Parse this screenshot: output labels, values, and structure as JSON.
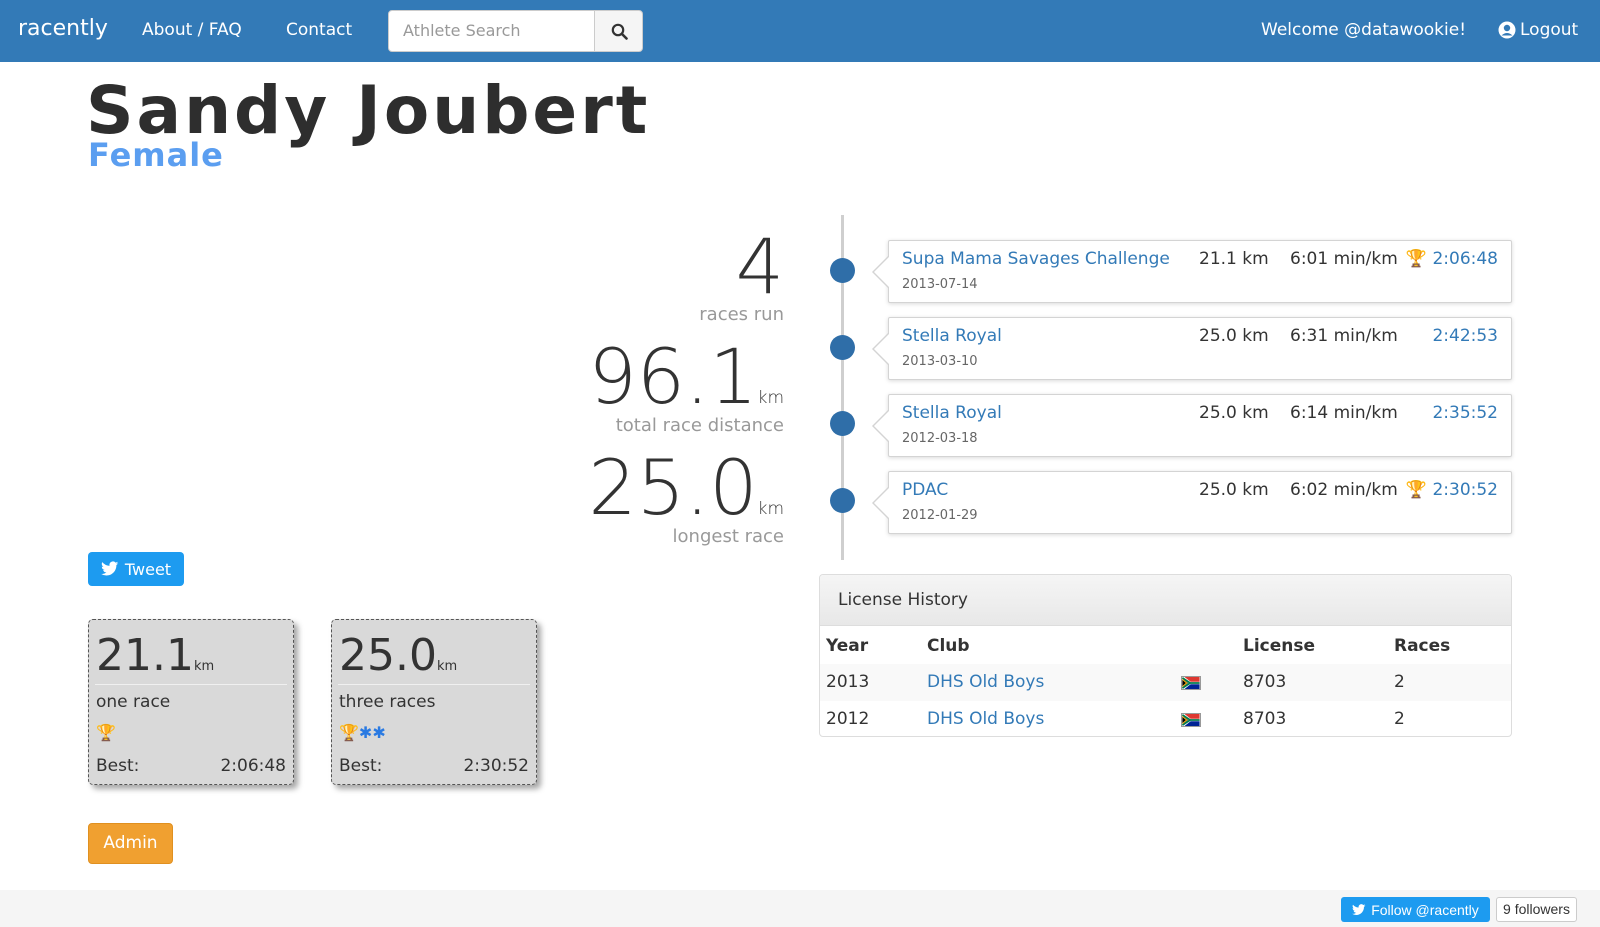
{
  "navbar": {
    "brand": "racently",
    "links": [
      "About / FAQ",
      "Contact"
    ],
    "search_placeholder": "Athlete Search",
    "welcome": "Welcome @datawookie!",
    "logout": "Logout"
  },
  "athlete": {
    "name": "Sandy Joubert",
    "gender": "Female"
  },
  "stats": {
    "races_run": "4",
    "races_run_label": "races run",
    "total_distance": "96.1",
    "total_distance_unit": "km",
    "total_distance_label": "total race distance",
    "longest": "25.0",
    "longest_unit": "km",
    "longest_label": "longest race"
  },
  "tweet_label": "Tweet",
  "distance_cards": [
    {
      "distance": "21.1",
      "unit": "km",
      "count": "one race",
      "trophies": 1,
      "stars": 0,
      "best_label": "Best:",
      "best_time": "2:06:48"
    },
    {
      "distance": "25.0",
      "unit": "km",
      "count": "three races",
      "trophies": 1,
      "stars": 2,
      "best_label": "Best:",
      "best_time": "2:30:52"
    }
  ],
  "admin_label": "Admin",
  "timeline": [
    {
      "name": "Supa Mama Savages Challenge",
      "date": "2013-07-14",
      "distance": "21.1 km",
      "pace": "6:01 min/km",
      "time": "2:06:48",
      "trophy": true
    },
    {
      "name": "Stella Royal",
      "date": "2013-03-10",
      "distance": "25.0 km",
      "pace": "6:31 min/km",
      "time": "2:42:53",
      "trophy": false
    },
    {
      "name": "Stella Royal",
      "date": "2012-03-18",
      "distance": "25.0 km",
      "pace": "6:14 min/km",
      "time": "2:35:52",
      "trophy": false
    },
    {
      "name": "PDAC",
      "date": "2012-01-29",
      "distance": "25.0 km",
      "pace": "6:02 min/km",
      "time": "2:30:52",
      "trophy": true
    }
  ],
  "license": {
    "title": "License History",
    "headers": [
      "Year",
      "Club",
      "License",
      "Races"
    ],
    "rows": [
      {
        "year": "2013",
        "club": "DHS Old Boys",
        "license": "8703",
        "races": "2"
      },
      {
        "year": "2012",
        "club": "DHS Old Boys",
        "license": "8703",
        "races": "2"
      }
    ]
  },
  "footer": {
    "follow_label": "Follow @racently",
    "followers": "9 followers"
  },
  "colors": {
    "navbar": "#337ab7",
    "gender": "#5b9ef0",
    "timeline_dot": "#2f6ea8",
    "trophy": "#d4a62a",
    "admin": "#f0a030"
  }
}
